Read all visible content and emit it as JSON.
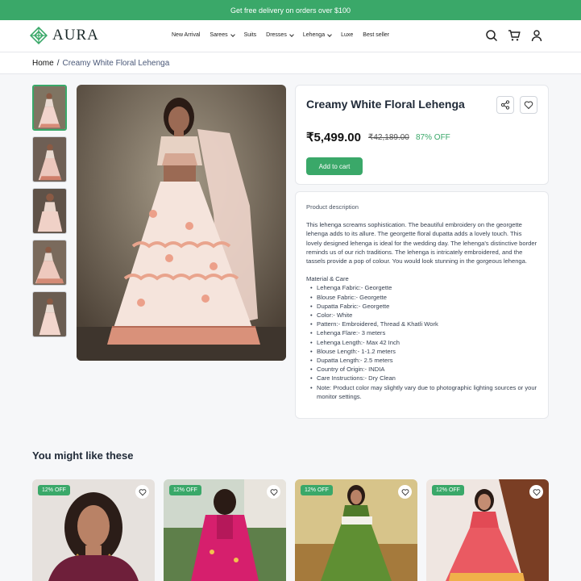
{
  "promo": {
    "text": "Get free delivery on orders over $100"
  },
  "brand": {
    "name": "AURA",
    "logo_icon": "diamond-knot-icon",
    "accent": "#3aa869"
  },
  "nav": {
    "items": [
      {
        "label": "New Arrival",
        "dropdown": false
      },
      {
        "label": "Sarees",
        "dropdown": true
      },
      {
        "label": "Suits",
        "dropdown": false
      },
      {
        "label": "Dresses",
        "dropdown": true
      },
      {
        "label": "Lehenga",
        "dropdown": true
      },
      {
        "label": "Luxe",
        "dropdown": false
      },
      {
        "label": "Best seller",
        "dropdown": false
      }
    ],
    "icons": [
      "search-icon",
      "cart-icon",
      "user-icon"
    ]
  },
  "breadcrumb": {
    "home": "Home",
    "separator": "/",
    "current": "Creamy White Floral Lehenga"
  },
  "product": {
    "title": "Creamy White Floral Lehenga",
    "price": "₹5,499.00",
    "old_price": "₹42,189.00",
    "discount": "87% OFF",
    "add_to_cart": "Add to cart",
    "thumbnail_count": 5
  },
  "description": {
    "heading": "Product description",
    "body": "This lehenga screams sophistication. The beautiful embroidery on the georgette lehenga adds to its allure. The georgette floral dupatta adds a lovely touch. This lovely designed lehenga is ideal for the wedding day. The lehenga's distinctive border reminds us of our rich traditions. The lehenga is intricately embroidered, and the tassels provide a pop of colour. You would look stunning in the gorgeous lehenga.",
    "care_heading": "Material & Care",
    "care_items": [
      "Lehenga Fabric:- Georgette",
      "Blouse Fabric:- Georgette",
      "Dupatta Fabric:- Georgette",
      "Color:- White",
      "Pattern:- Embroidered, Thread & Khatli Work",
      "Lehenga Flare:- 3 meters",
      "Lehenga Length:- Max 42 Inch",
      "Blouse Length:- 1-1.2 meters",
      "Dupatta Length:- 2.5 meters",
      "Country of Origin:- INDIA",
      "Care Instructions:- Dry Clean",
      "Note: Product color may slightly vary due to photographic lighting sources or your monitor settings."
    ]
  },
  "recommendations": {
    "title": "You might like these",
    "items": [
      {
        "badge": "12% OFF"
      },
      {
        "badge": "12% OFF"
      },
      {
        "badge": "12% OFF"
      },
      {
        "badge": "12% OFF"
      }
    ]
  }
}
